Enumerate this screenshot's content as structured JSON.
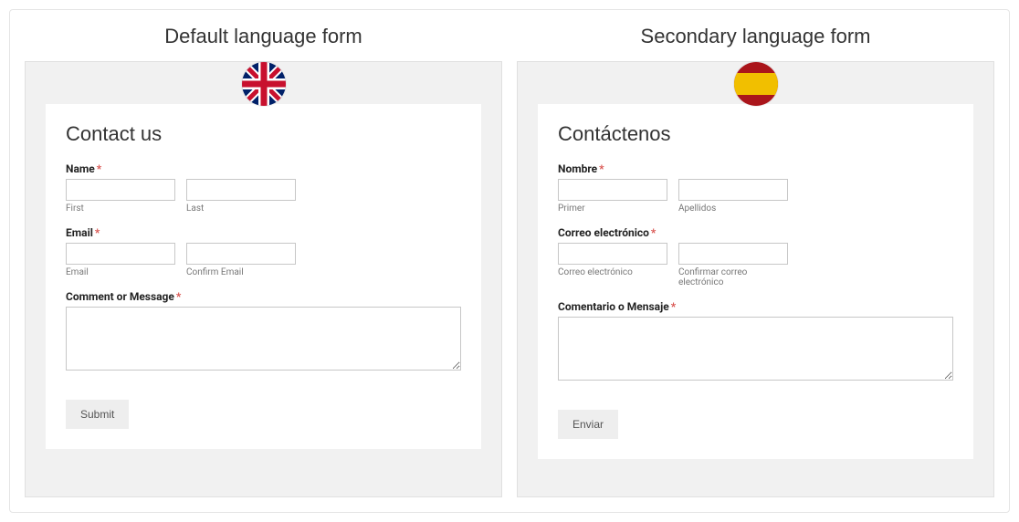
{
  "panels": {
    "default": {
      "title": "Default language form",
      "flag": "uk",
      "heading": "Contact us",
      "name": {
        "label": "Name",
        "first_sublabel": "First",
        "last_sublabel": "Last"
      },
      "email": {
        "label": "Email",
        "email_sublabel": "Email",
        "confirm_sublabel": "Confirm Email"
      },
      "comment": {
        "label": "Comment or Message"
      },
      "submit": "Submit"
    },
    "secondary": {
      "title": "Secondary language form",
      "flag": "spain",
      "heading": "Contáctenos",
      "name": {
        "label": "Nombre",
        "first_sublabel": "Primer",
        "last_sublabel": "Apellidos"
      },
      "email": {
        "label": "Correo electrónico",
        "email_sublabel": "Correo electrónico",
        "confirm_sublabel": "Confirmar correo electrónico"
      },
      "comment": {
        "label": "Comentario o Mensaje"
      },
      "submit": "Enviar"
    }
  },
  "required_mark": "*"
}
